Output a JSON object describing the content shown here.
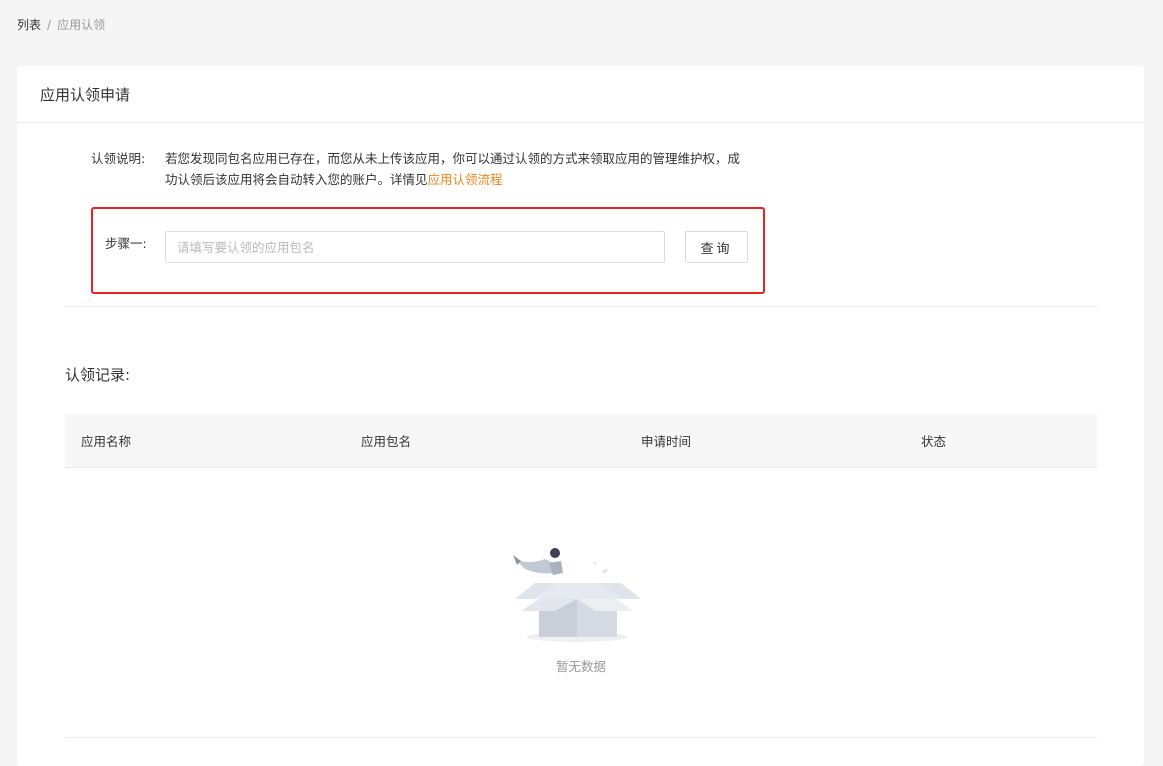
{
  "breadcrumb": {
    "root": "列表",
    "separator": "/",
    "current": "应用认领"
  },
  "card": {
    "title": "应用认领申请"
  },
  "description": {
    "label": "认领说明:",
    "text": "若您发现同包名应用已存在，而您从未上传该应用，你可以通过认领的方式来领取应用的管理维护权，成功认领后该应用将会自动转入您的账户。详情见",
    "link_text": "应用认领流程"
  },
  "step": {
    "label": "步骤一:",
    "input_value": "",
    "input_placeholder": "请填写要认领的应用包名",
    "query_button": "查询"
  },
  "records": {
    "title": "认领记录:",
    "columns": [
      "应用名称",
      "应用包名",
      "申请时间",
      "状态"
    ],
    "rows": [],
    "empty_text": "暂无数据"
  },
  "colors": {
    "highlight_border": "#e8231f",
    "link": "#f08519",
    "page_bg": "#f5f5f5"
  }
}
